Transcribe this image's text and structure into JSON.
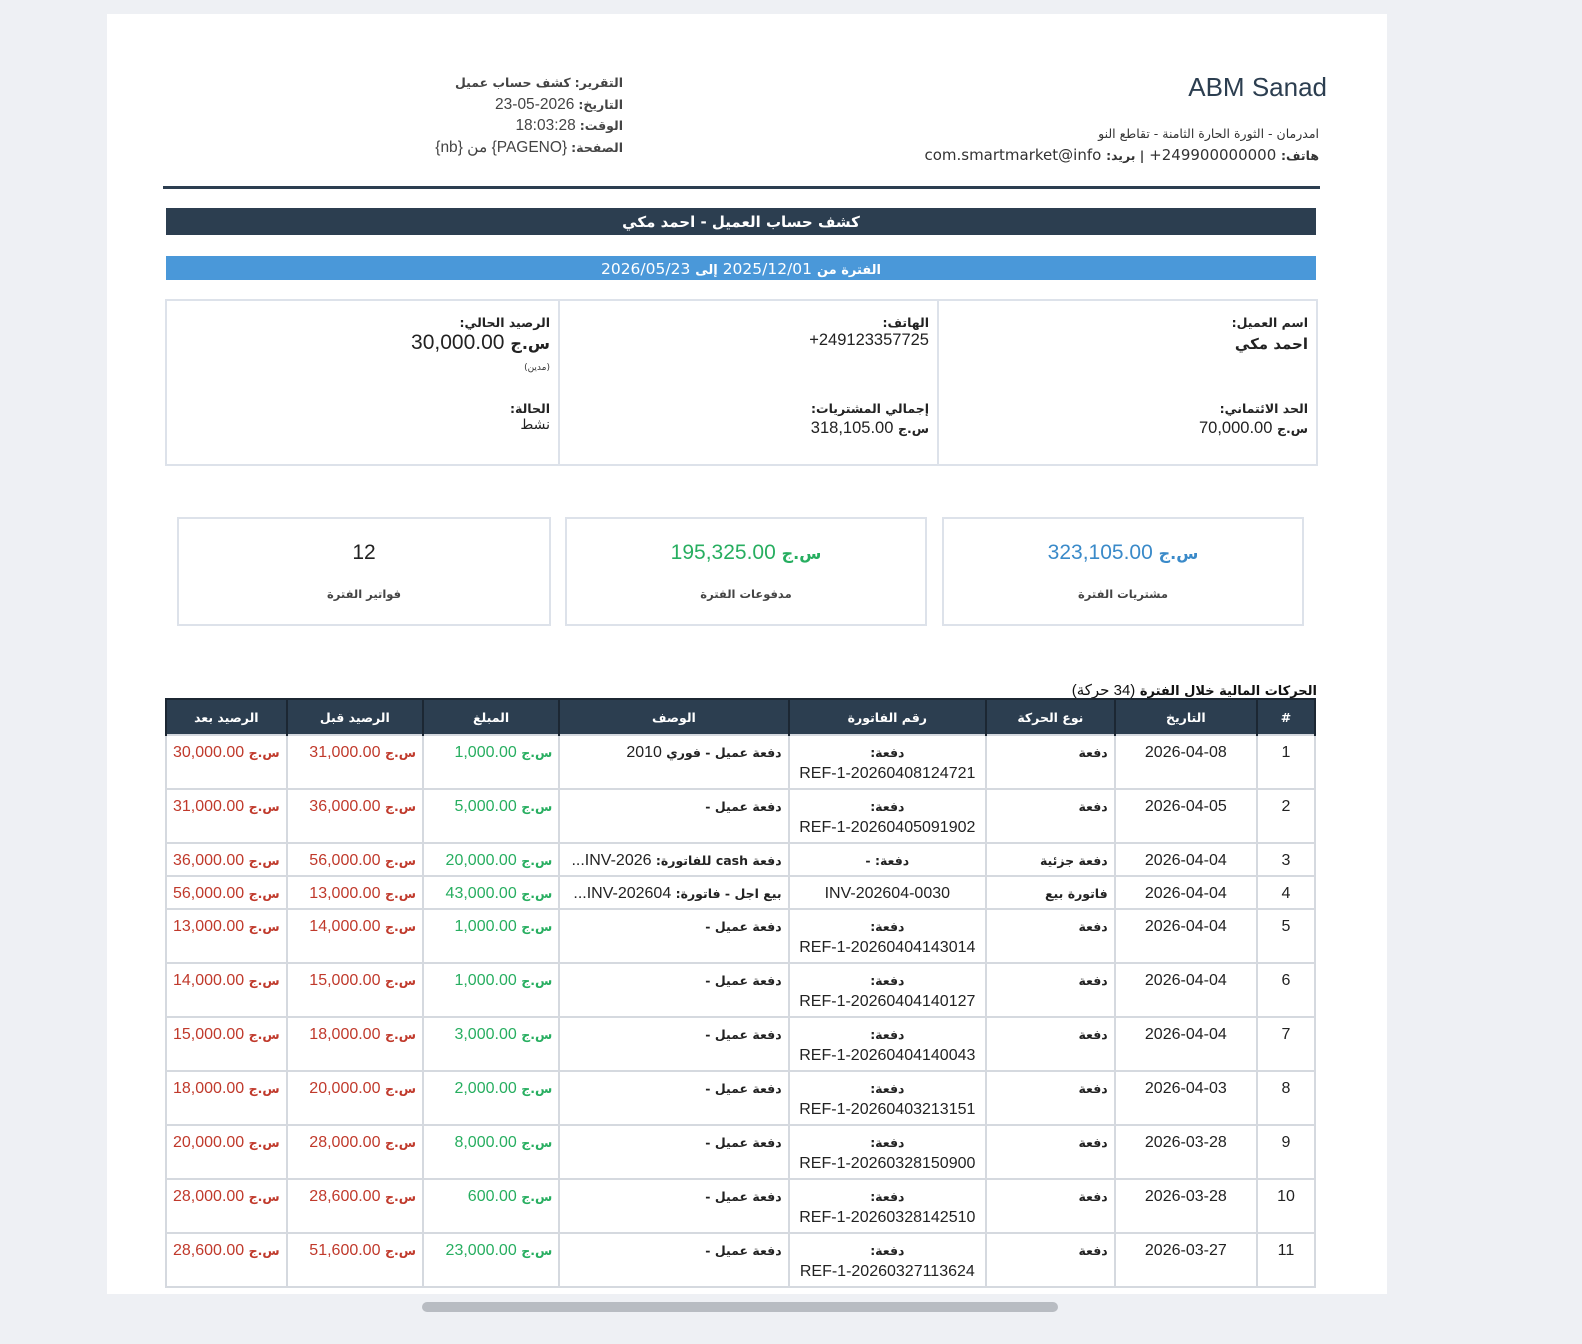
{
  "header": {
    "company_name": "ABM Sanad",
    "address": "امدرمان - الثورة الحارة الثامنة - تقاطع النو",
    "phone_label": "هاتف:",
    "phone_value": "+249900000000",
    "email_label": "| بريد:",
    "email_value": "com.smartmarket@info"
  },
  "meta": {
    "report_label": "التقرير:",
    "report_value": "كشف حساب عميل",
    "date_label": "التاريخ:",
    "date_value": "2026-05-23",
    "time_label": "الوقت:",
    "time_value": "18:03:28",
    "page_label": "الصفحة:",
    "page_value": "{PAGENO} من {nb}"
  },
  "title": "كشف حساب العميل - احمد مكي",
  "period": {
    "label": "الفترة من",
    "from": "2025/12/01",
    "to_label": "إلى",
    "to": "2026/05/23"
  },
  "customer": {
    "name_label": "اسم العميل:",
    "name": "احمد مكي",
    "credit_label": "الحد الائتماني:",
    "credit_value": "70,000.00",
    "phone_label": "الهاتف:",
    "phone_value": "+249123357725",
    "total_purchases_label": "إجمالي المشتريات:",
    "total_purchases_value": "318,105.00",
    "balance_label": "الرصيد الحالي:",
    "balance_value": "30,000.00",
    "balance_note": "(مدين)",
    "status_label": "الحالة:",
    "status_value": "نشط",
    "currency": "س.ج"
  },
  "stats": [
    {
      "value": "323,105.00",
      "currency": "س.ج",
      "label": "مشتريات الفترة"
    },
    {
      "value": "195,325.00",
      "currency": "س.ج",
      "label": "مدفوعات الفترة"
    },
    {
      "value": "12",
      "currency": "",
      "label": "فواتير الفترة"
    }
  ],
  "table": {
    "caption": "الحركات المالية خلال الفترة",
    "caption_count": "(34 حركة)",
    "headers": [
      "#",
      "التاريخ",
      "نوع الحركة",
      "رقم الفاتورة",
      "الوصف",
      "المبلغ",
      "الرصيد قبل",
      "الرصيد بعد"
    ],
    "rows": [
      {
        "no": "1",
        "date": "2026-04-08",
        "type": "دفعة",
        "ref_label": "دفعة:",
        "ref": "REF-1-20260408124721",
        "desc": "دفعة عميل - فوري",
        "desc_extra": "2010",
        "amount": "1,000.00",
        "before": "31,000.00",
        "after": "30,000.00"
      },
      {
        "no": "2",
        "date": "2026-04-05",
        "type": "دفعة",
        "ref_label": "دفعة:",
        "ref": "REF-1-20260405091902",
        "desc": "دفعة عميل -",
        "desc_extra": "",
        "amount": "5,000.00",
        "before": "36,000.00",
        "after": "31,000.00"
      },
      {
        "no": "3",
        "date": "2026-04-04",
        "type": "دفعة جزئية",
        "ref_label": "دفعة: -",
        "ref": "",
        "desc": "دفعة cash للفاتورة:",
        "desc_extra": "INV-2026...",
        "amount": "20,000.00",
        "before": "56,000.00",
        "after": "36,000.00"
      },
      {
        "no": "4",
        "date": "2026-04-04",
        "type": "فاتورة بيع",
        "ref_label": "",
        "ref": "INV-202604-0030",
        "desc": "بيع اجل - فاتورة:",
        "desc_extra": "INV-202604...",
        "amount": "43,000.00",
        "before": "13,000.00",
        "after": "56,000.00"
      },
      {
        "no": "5",
        "date": "2026-04-04",
        "type": "دفعة",
        "ref_label": "دفعة:",
        "ref": "REF-1-20260404143014",
        "desc": "دفعة عميل -",
        "desc_extra": "",
        "amount": "1,000.00",
        "before": "14,000.00",
        "after": "13,000.00"
      },
      {
        "no": "6",
        "date": "2026-04-04",
        "type": "دفعة",
        "ref_label": "دفعة:",
        "ref": "REF-1-20260404140127",
        "desc": "دفعة عميل -",
        "desc_extra": "",
        "amount": "1,000.00",
        "before": "15,000.00",
        "after": "14,000.00"
      },
      {
        "no": "7",
        "date": "2026-04-04",
        "type": "دفعة",
        "ref_label": "دفعة:",
        "ref": "REF-1-20260404140043",
        "desc": "دفعة عميل -",
        "desc_extra": "",
        "amount": "3,000.00",
        "before": "18,000.00",
        "after": "15,000.00"
      },
      {
        "no": "8",
        "date": "2026-04-03",
        "type": "دفعة",
        "ref_label": "دفعة:",
        "ref": "REF-1-20260403213151",
        "desc": "دفعة عميل -",
        "desc_extra": "",
        "amount": "2,000.00",
        "before": "20,000.00",
        "after": "18,000.00"
      },
      {
        "no": "9",
        "date": "2026-03-28",
        "type": "دفعة",
        "ref_label": "دفعة:",
        "ref": "REF-1-20260328150900",
        "desc": "دفعة عميل -",
        "desc_extra": "",
        "amount": "8,000.00",
        "before": "28,000.00",
        "after": "20,000.00"
      },
      {
        "no": "10",
        "date": "2026-03-28",
        "type": "دفعة",
        "ref_label": "دفعة:",
        "ref": "REF-1-20260328142510",
        "desc": "دفعة عميل -",
        "desc_extra": "",
        "amount": "600.00",
        "before": "28,600.00",
        "after": "28,000.00"
      },
      {
        "no": "11",
        "date": "2026-03-27",
        "type": "دفعة",
        "ref_label": "دفعة:",
        "ref": "REF-1-20260327113624",
        "desc": "دفعة عميل -",
        "desc_extra": "",
        "amount": "23,000.00",
        "before": "51,600.00",
        "after": "28,600.00"
      }
    ]
  },
  "colors": {
    "dark": "#2c3e50",
    "blue": "#4a98d9",
    "red": "#c0392b",
    "green": "#27ae60"
  }
}
